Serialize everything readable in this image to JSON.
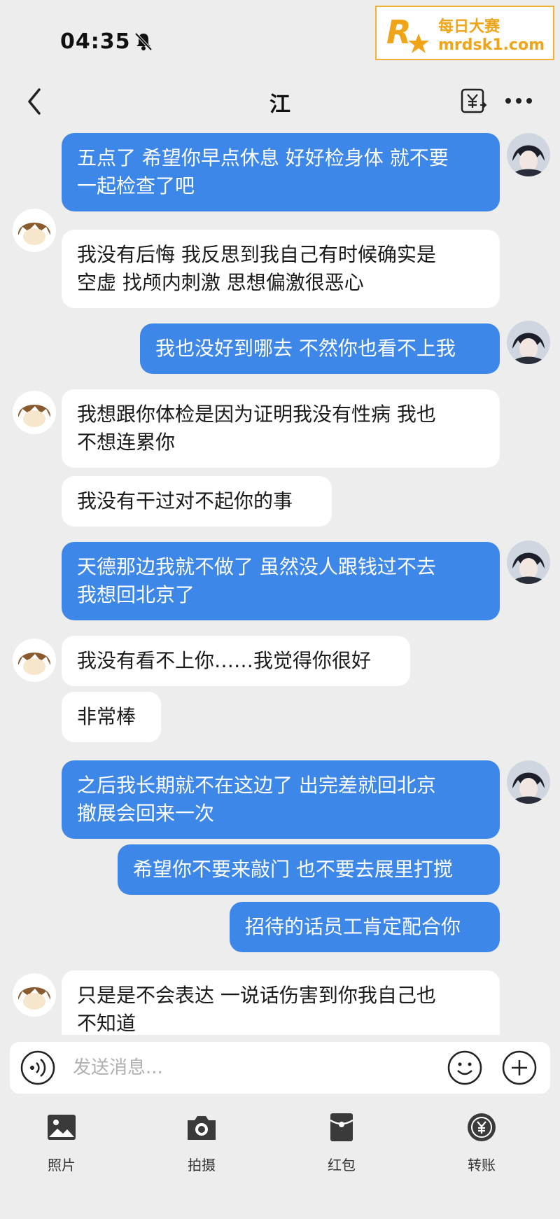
{
  "status_bar": {
    "time": "04:35"
  },
  "watermark": {
    "line1": "每日大赛",
    "line2": "mrdsk1.com",
    "logo_letter": "R"
  },
  "header": {
    "title": "江"
  },
  "messages": [
    {
      "side": "out",
      "text": "五点了 希望你早点休息 好好检身体 就不要\n一起检查了吧"
    },
    {
      "side": "in",
      "text": "我没有后悔 我反思到我自己有时候确实是\n空虚 找颅内刺激 思想偏激很恶心"
    },
    {
      "side": "out",
      "text": "我也没好到哪去 不然你也看不上我"
    },
    {
      "side": "in",
      "text": "我想跟你体检是因为证明我没有性病 我也\n不想连累你"
    },
    {
      "side": "in",
      "text": "我没有干过对不起你的事"
    },
    {
      "side": "out",
      "text": "天德那边我就不做了 虽然没人跟钱过不去\n我想回北京了"
    },
    {
      "side": "in",
      "text": "我没有看不上你……我觉得你很好"
    },
    {
      "side": "in",
      "text": "非常棒"
    },
    {
      "side": "out",
      "text": "之后我长期就不在这边了 出完差就回北京\n撤展会回来一次"
    },
    {
      "side": "out",
      "text": "希望你不要来敲门 也不要去展里打搅"
    },
    {
      "side": "out",
      "text": "招待的话员工肯定配合你"
    },
    {
      "side": "in",
      "text": "只是是不会表达 一说话伤害到你我自己也\n不知道"
    }
  ],
  "input": {
    "placeholder": "发送消息..."
  },
  "tools": [
    {
      "label": "照片",
      "icon": "photo-icon"
    },
    {
      "label": "拍摄",
      "icon": "camera-icon"
    },
    {
      "label": "红包",
      "icon": "red-envelope-icon"
    },
    {
      "label": "转账",
      "icon": "transfer-icon"
    }
  ],
  "colors": {
    "outgoing_bubble": "#3d87e8",
    "incoming_bubble": "#ffffff",
    "background": "#ededed",
    "watermark": "#f0a418"
  }
}
